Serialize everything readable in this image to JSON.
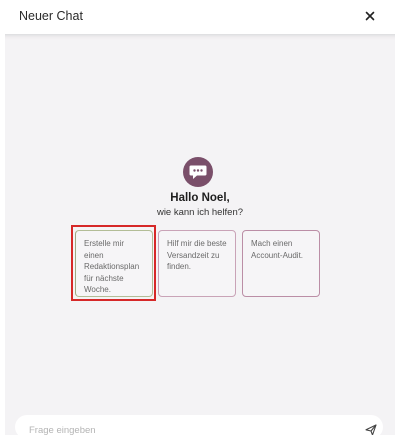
{
  "header": {
    "title": "Neuer Chat",
    "close_icon": "close-icon"
  },
  "welcome": {
    "avatar_icon": "chat-bubble-icon",
    "avatar_color": "#7a4f6a",
    "greeting": "Hallo Noel,",
    "subtitle": "wie kann ich helfen?"
  },
  "suggestions": [
    {
      "text": "Erstelle mir einen Redaktionsplan für nächste Woche.",
      "highlighted": true
    },
    {
      "text": "Hilf mir die beste Versandzeit zu finden.",
      "highlighted": false
    },
    {
      "text": "Mach einen Account-Audit.",
      "highlighted": false
    }
  ],
  "composer": {
    "placeholder": "Frage eingeben",
    "send_icon": "send-icon"
  },
  "colors": {
    "highlight": "#d62828",
    "background": "#f4f3f5"
  }
}
